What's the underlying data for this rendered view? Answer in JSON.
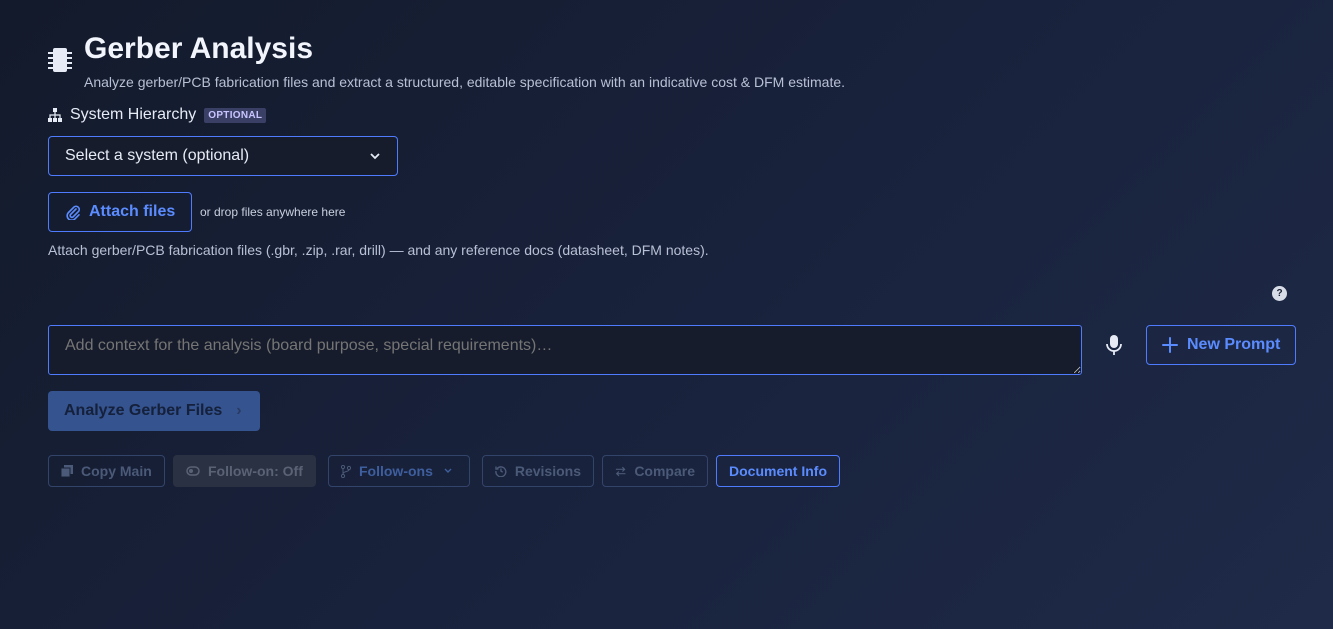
{
  "header": {
    "title": "Gerber Analysis",
    "subtitle": "Analyze gerber/PCB fabrication files and extract a structured, editable specification with an indicative cost & DFM estimate.",
    "icon": "chip-icon"
  },
  "hierarchy": {
    "label": "System Hierarchy",
    "badge": "OPTIONAL",
    "select_value": "Select a system (optional)"
  },
  "attach": {
    "button_label": "Attach files",
    "drop_hint": "or drop files anywhere here",
    "help_text": "Attach gerber/PCB fabrication files (.gbr, .zip, .rar, drill) — and any reference docs (datasheet, DFM notes)."
  },
  "help": {
    "glyph": "?"
  },
  "prompt": {
    "placeholder": "Add context for the analysis (board purpose, special requirements)…",
    "new_prompt_label": "New Prompt"
  },
  "analyze": {
    "label": "Analyze Gerber Files",
    "arrow": "›"
  },
  "toolbar": {
    "copy_main": "Copy Main",
    "follow_on_toggle": "Follow-on: Off",
    "follow_ons": "Follow-ons",
    "revisions": "Revisions",
    "compare": "Compare",
    "document_info": "Document Info"
  },
  "colors": {
    "accent": "#5b8cff",
    "accent_border": "#4f7bff",
    "analyze_bg": "#34538f"
  }
}
